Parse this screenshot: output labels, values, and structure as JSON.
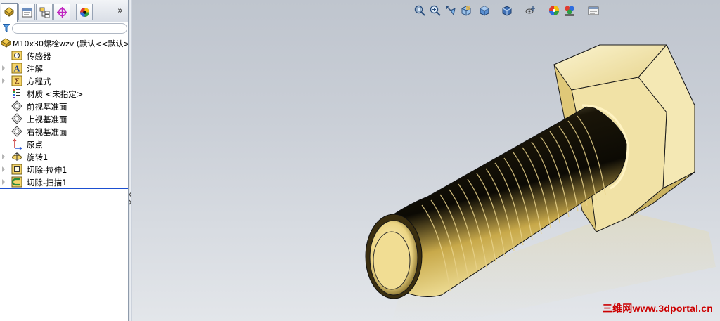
{
  "panel": {
    "tabs": [
      {
        "name": "featuremanager-tab",
        "icon": "feature-tree-icon"
      },
      {
        "name": "propertymanager-tab",
        "icon": "property-manager-icon"
      },
      {
        "name": "configurationmanager-tab",
        "icon": "configuration-icon"
      },
      {
        "name": "dimxpert-tab",
        "icon": "dimxpert-icon"
      },
      {
        "name": "display-manager-tab",
        "icon": "appearance-icon"
      }
    ],
    "more": "»",
    "filter_placeholder": ""
  },
  "tree": {
    "root": "M10x30螺栓wzv  (默认<<默认>_",
    "items": [
      {
        "label": "传感器",
        "icon": "sensor-icon",
        "expandable": false
      },
      {
        "label": "注解",
        "icon": "annotation-icon",
        "expandable": true
      },
      {
        "label": "方程式",
        "icon": "equation-icon",
        "expandable": true
      },
      {
        "label": "材质 <未指定>",
        "icon": "material-icon",
        "expandable": false
      },
      {
        "label": "前视基准面",
        "icon": "plane-icon",
        "expandable": false
      },
      {
        "label": "上视基准面",
        "icon": "plane-icon",
        "expandable": false
      },
      {
        "label": "右视基准面",
        "icon": "plane-icon",
        "expandable": false
      },
      {
        "label": "原点",
        "icon": "origin-icon",
        "expandable": false
      },
      {
        "label": "旋转1",
        "icon": "revolve-icon",
        "expandable": true
      },
      {
        "label": "切除-拉伸1",
        "icon": "cut-extrude-icon",
        "expandable": true
      },
      {
        "label": "切除-扫描1",
        "icon": "cut-sweep-icon",
        "expandable": true
      }
    ]
  },
  "view_toolbar": [
    "zoom-to-fit-icon",
    "zoom-to-area-icon",
    "previous-view-icon",
    "section-view-icon",
    "view-orientation-icon",
    "display-style-icon",
    "hide-show-items-icon",
    "edit-appearance-icon",
    "apply-scene-icon",
    "view-settings-icon"
  ],
  "watermark": "三维网www.3dportal.cn",
  "colors": {
    "accent_blue": "#1b4fd1",
    "bolt_gold": "#e8d38e",
    "watermark_red": "#cc0000"
  }
}
